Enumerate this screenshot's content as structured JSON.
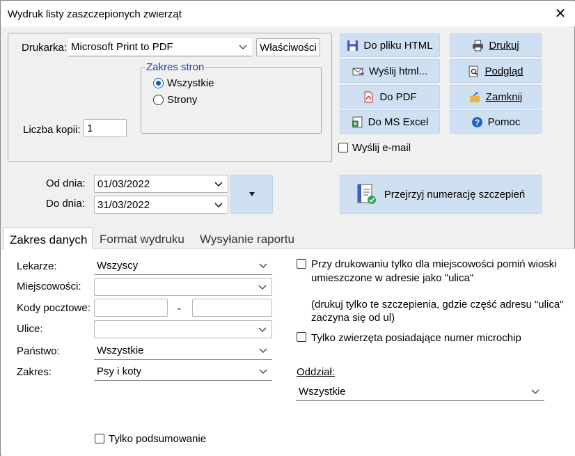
{
  "window": {
    "title": "Wydruk listy zaszczepionych zwierząt"
  },
  "printer": {
    "label": "Drukarka:",
    "value": "Microsoft Print to PDF",
    "properties_button": "Właściwości",
    "copies_label": "Liczba kopii:",
    "copies_value": "1"
  },
  "page_range": {
    "legend": "Zakres stron",
    "options": [
      "Wszystkie",
      "Strony"
    ],
    "selected": "Wszystkie"
  },
  "actions": {
    "html_file": "Do pliku HTML",
    "print": "Drukuj",
    "send_html": "Wyślij html...",
    "preview": "Podgląd",
    "pdf": "Do PDF",
    "close": "Zamknij",
    "excel": "Do MS Excel",
    "help": "Pomoc",
    "send_email": "Wyślij e-mail",
    "review_numbering": "Przejrzyj numerację szczepień"
  },
  "dates": {
    "from_label": "Od dnia:",
    "from_value": "01/03/2022",
    "to_label": "Do dnia:",
    "to_value": "31/03/2022"
  },
  "tabs": [
    "Zakres danych",
    "Format wydruku",
    "Wysyłanie raportu"
  ],
  "filters": {
    "doctors_label": "Lekarze:",
    "doctors_value": "Wszyscy",
    "towns_label": "Miejscowości:",
    "towns_value": "",
    "postcodes_label": "Kody pocztowe:",
    "postcode_from": "",
    "postcode_sep": "-",
    "postcode_to": "",
    "streets_label": "Ulice:",
    "streets_value": "",
    "country_label": "Państwo:",
    "country_value": "Wszystkie",
    "scope_label": "Zakres:",
    "scope_value": "Psy i koty",
    "summary_only": "Tylko podsumowanie"
  },
  "options": {
    "skip_villages_line1": "Przy drukowaniu tylko dla miejscowości pomiń wioski",
    "skip_villages_line2": "umieszczone w adresie jako \"ulica\"",
    "note_line1": "(drukuj tylko te szczepienia, gdzie część adresu \"ulica\"",
    "note_line2": "zaczyna się od ul)",
    "microchip_only": "Tylko zwierzęta posiadające numer microchip",
    "branch_label": "Oddział:",
    "branch_value": "Wszystkie"
  },
  "colors": {
    "button_bg": "#cfe0f3",
    "radio_accent": "#0a5fb4",
    "legend_text": "#1f3fbf"
  }
}
